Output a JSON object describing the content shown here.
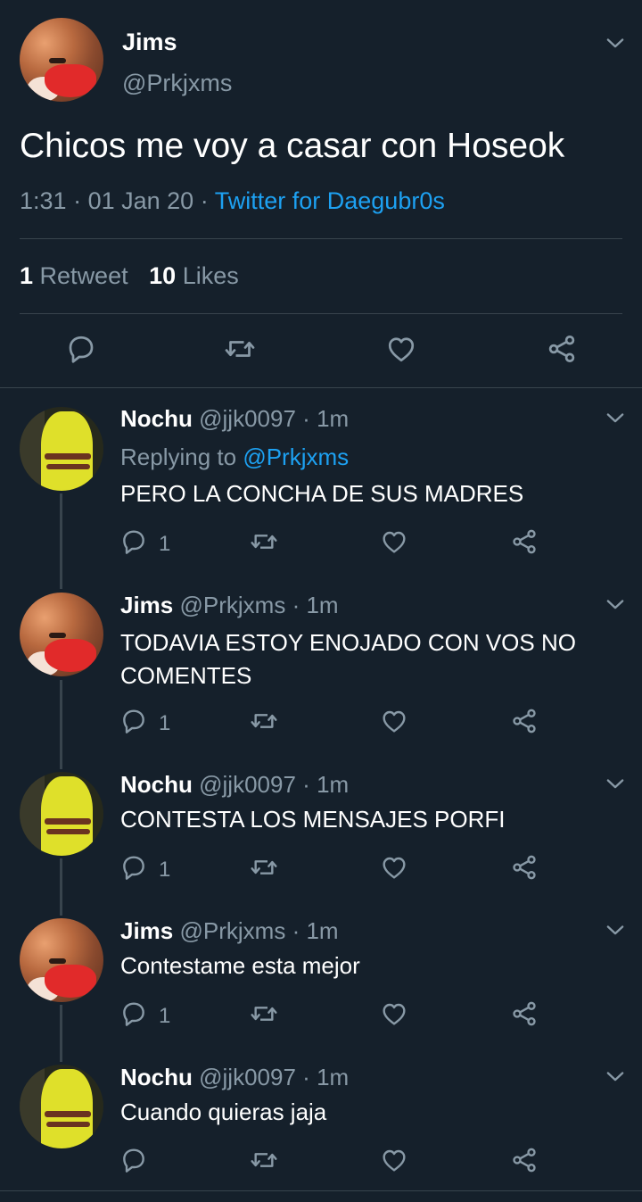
{
  "main_tweet": {
    "name": "Jims",
    "handle": "@Prkjxms",
    "text": "Chicos me voy a casar con Hoseok",
    "time": "1:31",
    "date": "01 Jan 20",
    "sep1": "·",
    "sep2": "·",
    "source": "Twitter for Daegubr0s",
    "retweets_count": "1",
    "retweets_label": "Retweet",
    "likes_count": "10",
    "likes_label": "Likes"
  },
  "replies": [
    {
      "name": "Nochu",
      "handle": "@jjk0097",
      "sep": "·",
      "time": "1m",
      "replying_prefix": "Replying to",
      "replying_to": "@Prkjxms",
      "text": "PERO LA CONCHA DE SUS MADRES",
      "reply_count": "1"
    },
    {
      "name": "Jims",
      "handle": "@Prkjxms",
      "sep": "·",
      "time": "1m",
      "text_line1": "TODAVIA ESTOY ENOJADO CON VOS NO",
      "text_line2": "COMENTES",
      "reply_count": "1"
    },
    {
      "name": "Nochu",
      "handle": "@jjk0097",
      "sep": "·",
      "time": "1m",
      "text": "CONTESTA LOS MENSAJES PORFI",
      "reply_count": "1"
    },
    {
      "name": "Jims",
      "handle": "@Prkjxms",
      "sep": "·",
      "time": "1m",
      "text": "Contestame esta mejor",
      "reply_count": "1"
    },
    {
      "name": "Nochu",
      "handle": "@jjk0097",
      "sep": "·",
      "time": "1m",
      "text": "Cuando quieras jaja",
      "reply_count": ""
    }
  ],
  "icons": {
    "reply": "reply-icon",
    "retweet": "retweet-icon",
    "like": "heart-icon",
    "share": "share-icon",
    "more": "chevron-down-icon"
  },
  "colors": {
    "background": "#15202b",
    "text": "#ffffff",
    "muted": "#8899a6",
    "link": "#1da1f2",
    "divider": "#38444d"
  }
}
